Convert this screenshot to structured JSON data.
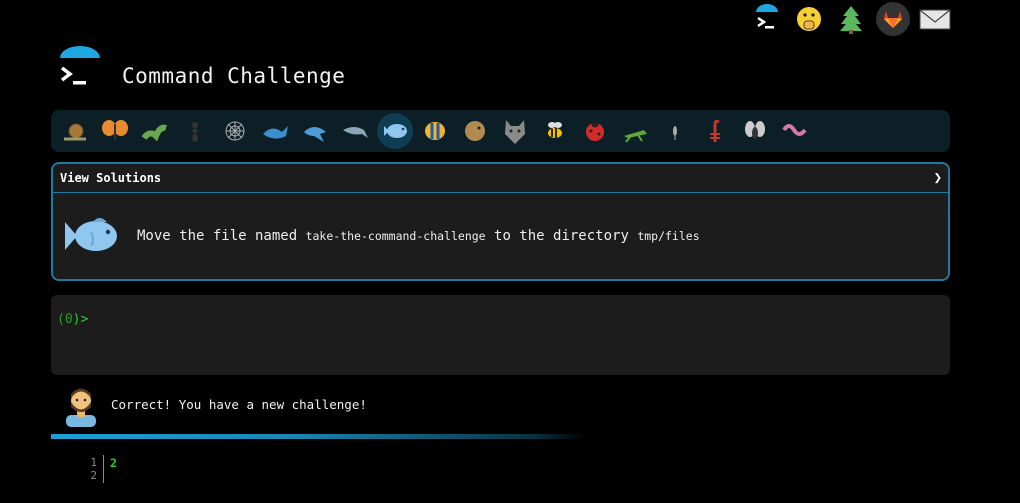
{
  "header": {
    "title": "Command Challenge"
  },
  "top_icons": [
    "terminal-icon",
    "shushing-face-icon",
    "evergreen-tree-icon",
    "gitlab-icon",
    "envelope-icon"
  ],
  "creatures": [
    "snail",
    "butterfly",
    "caterpillar",
    "ant",
    "spider-web",
    "whale",
    "shark",
    "dolphin",
    "fish",
    "tropical-fish",
    "blowfish",
    "wolf",
    "bee",
    "ladybug",
    "cricket",
    "mosquito",
    "scorpion",
    "fly",
    "worm"
  ],
  "active_creature": "fish",
  "challenge": {
    "solutions_label": "View Solutions",
    "chevron": "❯",
    "text_before": "Move the file named ",
    "file_name": "take-the-command-challenge",
    "text_middle": " to the directory ",
    "dir_name": "tmp/files"
  },
  "terminal": {
    "prompt_open": "(",
    "exit_code": "0",
    "prompt_close": ")>"
  },
  "feedback": {
    "message": "Correct! You have a new challenge!",
    "progress": 0.57
  },
  "editor": {
    "line_numbers": [
      "1",
      "2"
    ],
    "content": "2"
  },
  "colors": {
    "accent": "#1d9fd6",
    "prompt_green": "#2bd02b",
    "panel_bg": "#1c1c1c",
    "bar_bg": "#0c1f27"
  }
}
